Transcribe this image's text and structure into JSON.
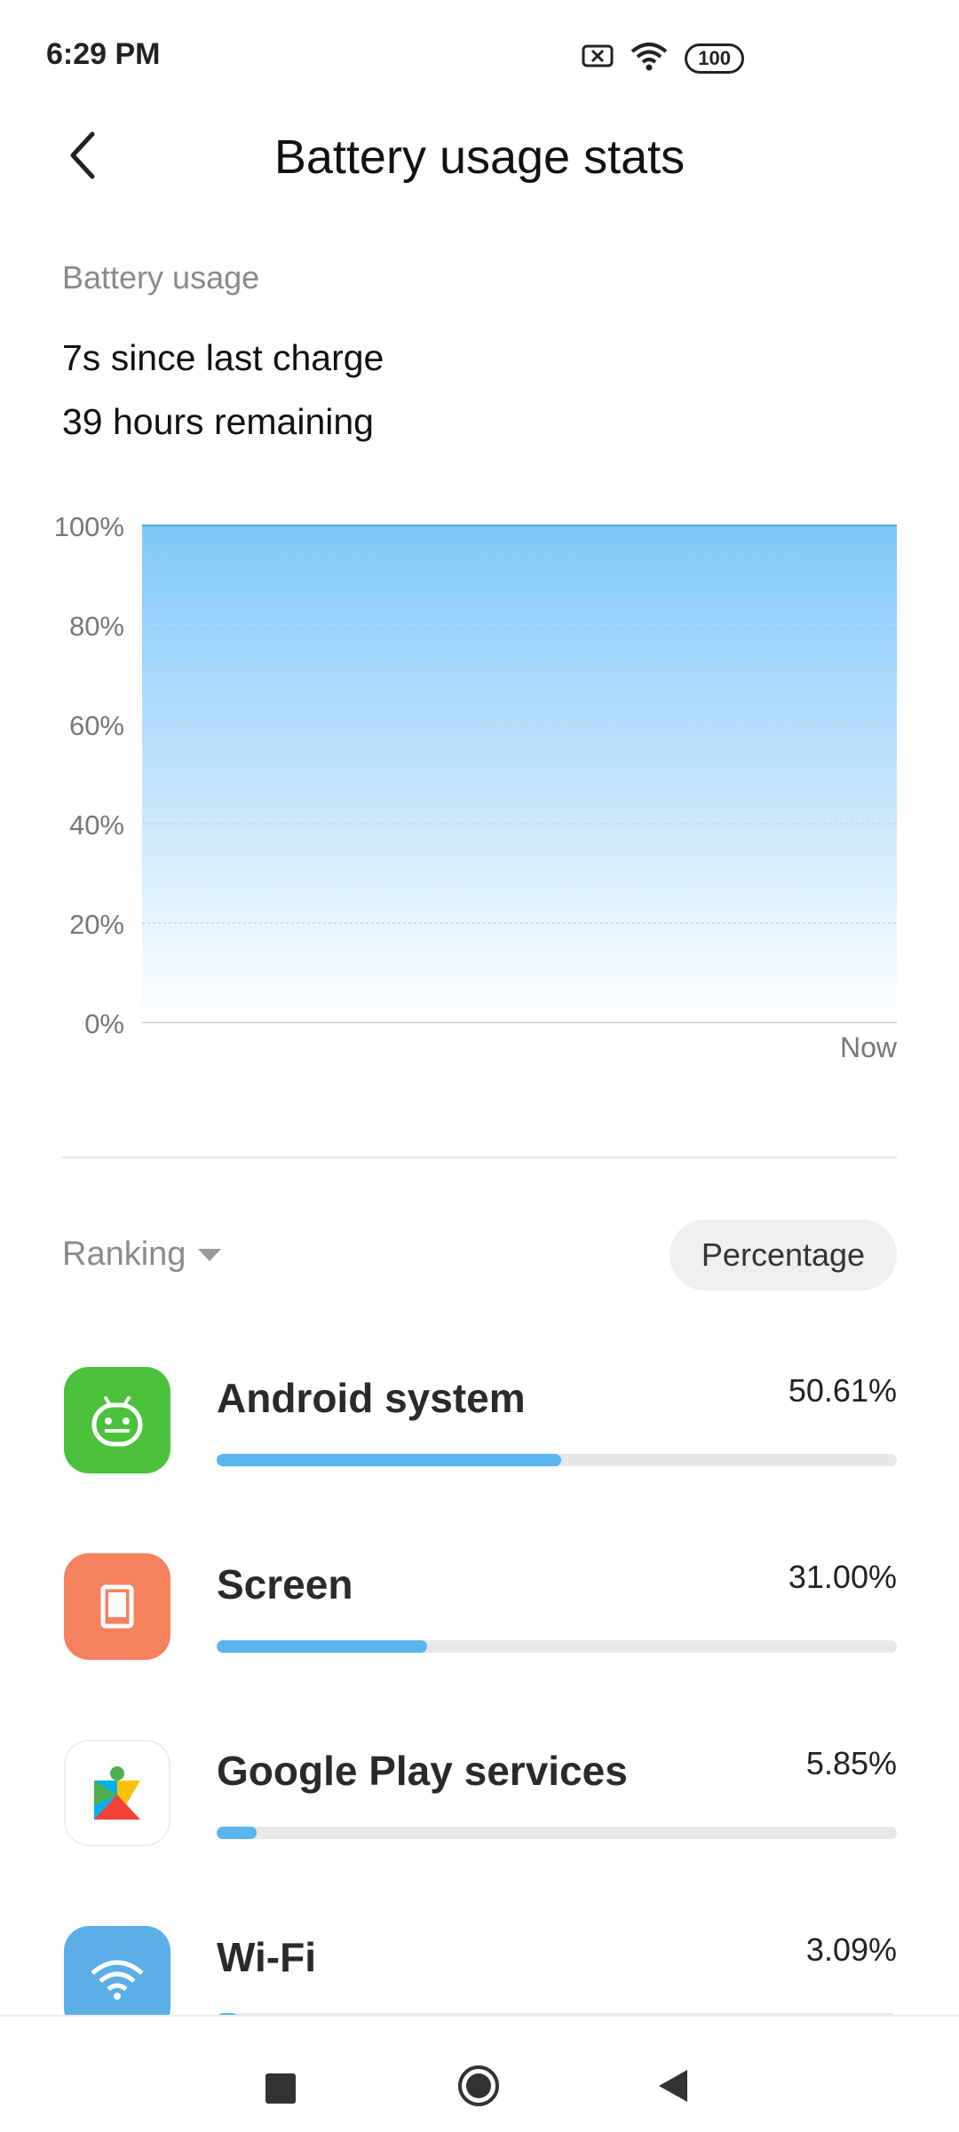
{
  "status_bar": {
    "time": "6:29 PM",
    "battery": "100"
  },
  "header": {
    "title": "Battery usage stats"
  },
  "usage": {
    "section_label": "Battery usage",
    "since_charge": "7s since last charge",
    "remaining": "39 hours remaining"
  },
  "chart_data": {
    "type": "area",
    "y_ticks": [
      "100%",
      "80%",
      "60%",
      "40%",
      "20%",
      "0%"
    ],
    "x_tick_labels": [
      "Now"
    ],
    "ylim": [
      0,
      100
    ],
    "series": [
      {
        "values": [
          100,
          100
        ]
      }
    ],
    "fill_colors": {
      "top": "#80c8f8",
      "bottom": "#ffffff",
      "line": "#4aa6dc"
    },
    "grid": true
  },
  "ranking": {
    "label": "Ranking",
    "mode_button": "Percentage"
  },
  "apps": [
    {
      "name": "Android system",
      "percent_label": "50.61%",
      "fraction": 0.5061,
      "icon": "android-icon",
      "icon_bg": "#4cc23c"
    },
    {
      "name": "Screen",
      "percent_label": "31.00%",
      "fraction": 0.31,
      "icon": "screen-icon",
      "icon_bg": "#f5815f"
    },
    {
      "name": "Google Play services",
      "percent_label": "5.85%",
      "fraction": 0.0585,
      "icon": "google-play-services-icon",
      "icon_bg": "#ffffff"
    },
    {
      "name": "Wi-Fi",
      "percent_label": "3.09%",
      "fraction": 0.0309,
      "icon": "wifi-icon",
      "icon_bg": "#5caee6"
    }
  ],
  "colors": {
    "accent_bar": "#5ab4ee",
    "track": "#e7e7e7"
  }
}
